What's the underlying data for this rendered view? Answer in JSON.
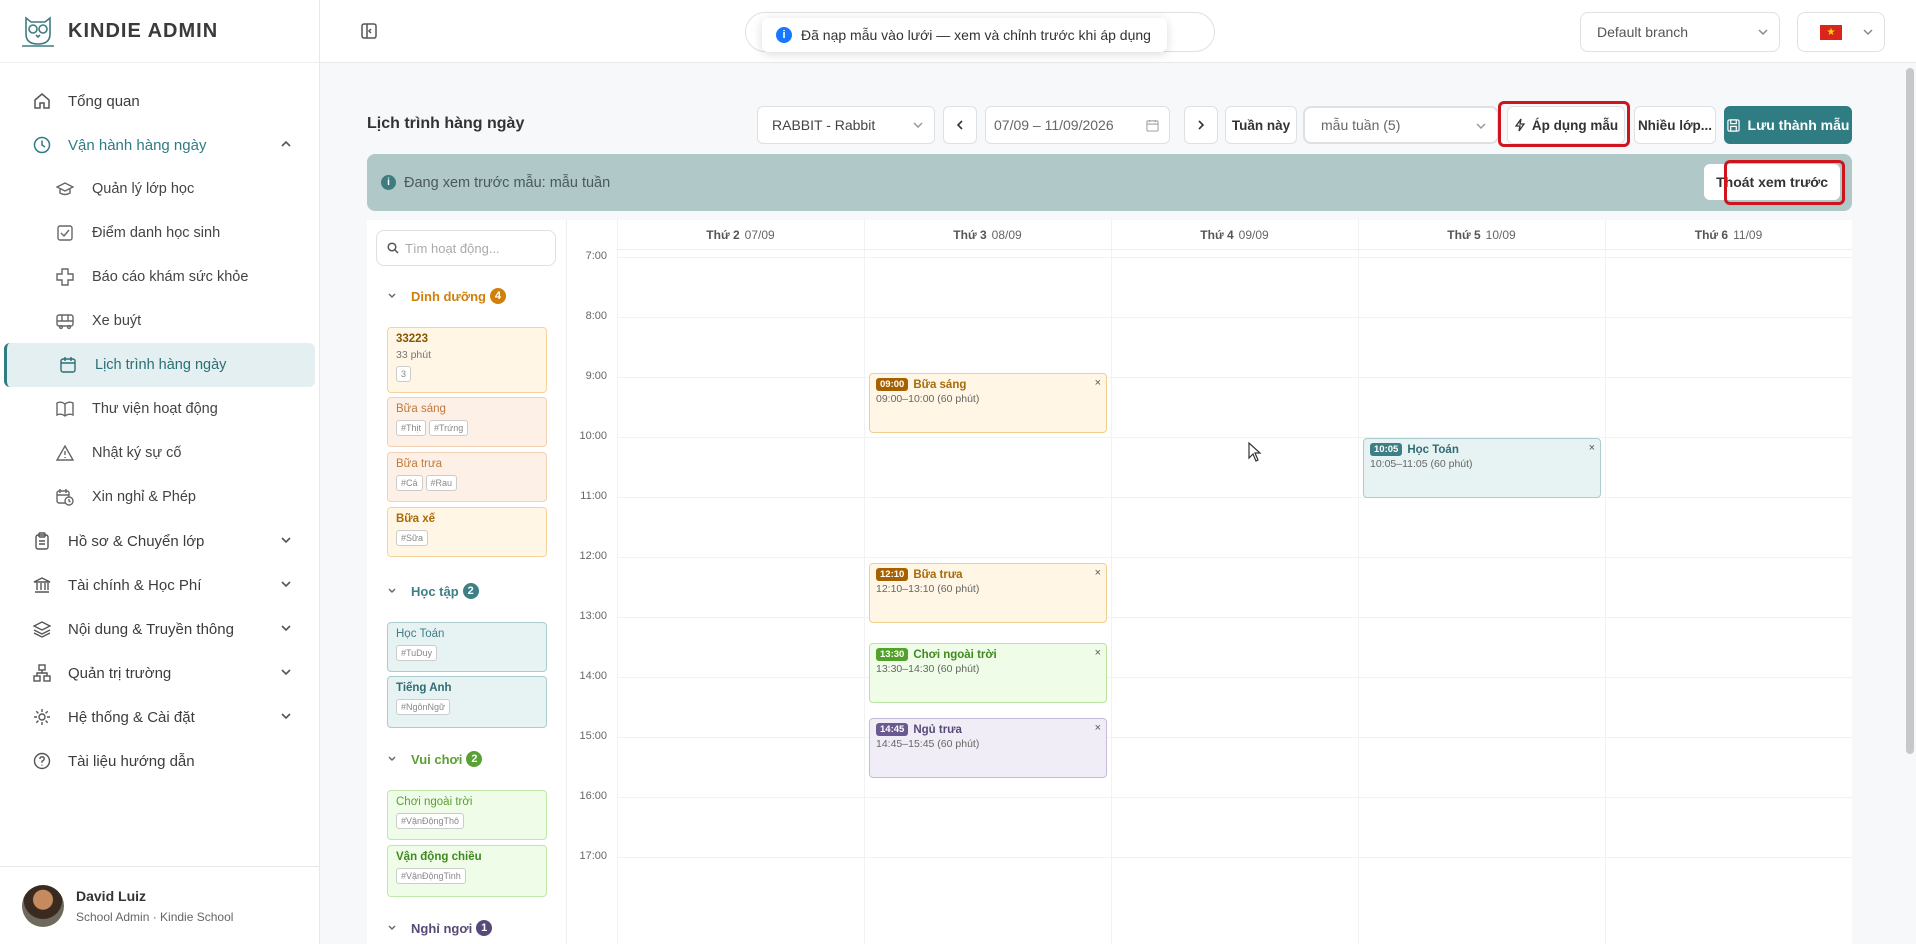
{
  "brand": {
    "name": "KINDIE ADMIN"
  },
  "nav": {
    "items": [
      {
        "label": "Tổng quan",
        "icon": "home-icon"
      },
      {
        "label": "Vận hành hàng ngày",
        "icon": "clock-icon"
      }
    ],
    "subitems": [
      {
        "label": "Quản lý lớp học",
        "icon": "graduation-cap-icon"
      },
      {
        "label": "Điểm danh học sinh",
        "icon": "checkbox-icon"
      },
      {
        "label": "Báo cáo khám sức khỏe",
        "icon": "health-cross-icon"
      },
      {
        "label": "Xe buýt",
        "icon": "bus-icon"
      },
      {
        "label": "Lịch trình hàng ngày",
        "icon": "calendar-icon"
      },
      {
        "label": "Thư viện hoạt động",
        "icon": "book-icon"
      },
      {
        "label": "Nhật ký sự cố",
        "icon": "warning-icon"
      },
      {
        "label": "Xin nghỉ & Phép",
        "icon": "calendar-clock-icon"
      }
    ],
    "bottom_items": [
      {
        "label": "Hồ sơ & Chuyển lớp",
        "icon": "clipboard-icon"
      },
      {
        "label": "Tài chính & Học Phí",
        "icon": "bank-icon"
      },
      {
        "label": "Nội dung & Truyền thông",
        "icon": "layers-icon"
      },
      {
        "label": "Quản trị trường",
        "icon": "hierarchy-icon"
      },
      {
        "label": "Hệ thống & Cài đặt",
        "icon": "gear-icon"
      },
      {
        "label": "Tài liệu hướng dẫn",
        "icon": "help-icon"
      }
    ]
  },
  "user": {
    "name": "David Luiz",
    "role": "School Admin · Kindie School"
  },
  "topbar": {
    "toast": "Đã nạp mẫu vào lưới — xem và chỉnh trước khi áp dụng",
    "branch": "Default branch"
  },
  "schedule": {
    "title": "Lịch trình hàng ngày",
    "class_select": "RABBIT - Rabbit",
    "date_range": "07/09 – 11/09/2026",
    "this_week": "Tuần này",
    "template_select": "mẫu tuần (5)",
    "apply_template": "Áp dụng mẫu",
    "multi_class": "Nhiều lớp...",
    "save_template": "Lưu thành mẫu",
    "preview_text": "Đang xem trước mẫu: mẫu tuần",
    "exit_preview": "Thoát xem trước"
  },
  "activities": {
    "search_placeholder": "Tìm hoạt động...",
    "groups": [
      {
        "name": "Dinh dưỡng",
        "count": "4",
        "color": "#d07f0b"
      },
      {
        "name": "Học tập",
        "count": "2",
        "color": "#3e7f86"
      },
      {
        "name": "Vui chơi",
        "count": "2",
        "color": "#5aa032"
      },
      {
        "name": "Nghỉ ngơi",
        "count": "1",
        "color": "#574a78"
      }
    ],
    "cards": [
      {
        "title": "33223",
        "sub": "33 phút",
        "tags": [
          "3"
        ]
      },
      {
        "title": "Bữa sáng",
        "tags": [
          "#Thịt",
          "#Trứng"
        ]
      },
      {
        "title": "Bữa trưa",
        "tags": [
          "#Cá",
          "#Rau"
        ]
      },
      {
        "title": "Bữa xế",
        "tags": [
          "#Sữa"
        ]
      },
      {
        "title": "Học Toán",
        "tags": [
          "#TuDuy"
        ]
      },
      {
        "title": "Tiếng Anh",
        "tags": [
          "#NgônNgữ"
        ]
      },
      {
        "title": "Chơi ngoài trời",
        "tags": [
          "#VậnĐộngThô"
        ]
      },
      {
        "title": "Vận động chiều",
        "tags": [
          "#VậnĐộngTinh"
        ]
      }
    ]
  },
  "calendar": {
    "days": [
      {
        "name": "Thứ 2",
        "date": "07/09"
      },
      {
        "name": "Thứ 3",
        "date": "08/09"
      },
      {
        "name": "Thứ 4",
        "date": "09/09"
      },
      {
        "name": "Thứ 5",
        "date": "10/09"
      },
      {
        "name": "Thứ 6",
        "date": "11/09"
      }
    ],
    "hours": [
      "7:00",
      "8:00",
      "9:00",
      "10:00",
      "11:00",
      "12:00",
      "13:00",
      "14:00",
      "15:00",
      "16:00",
      "17:00"
    ],
    "events": [
      {
        "time": "09:00",
        "title": "Bữa sáng",
        "range": "09:00–10:00 (60 phút)"
      },
      {
        "time": "12:10",
        "title": "Bữa trưa",
        "range": "12:10–13:10 (60 phút)"
      },
      {
        "time": "13:30",
        "title": "Chơi ngoài trời",
        "range": "13:30–14:30 (60 phút)"
      },
      {
        "time": "14:45",
        "title": "Ngủ trưa",
        "range": "14:45–15:45 (60 phút)"
      },
      {
        "time": "10:05",
        "title": "Học Toán",
        "range": "10:05–11:05 (60 phút)"
      }
    ]
  },
  "colors": {
    "accent": "#2f7c83",
    "highlight": "#d0141e"
  }
}
